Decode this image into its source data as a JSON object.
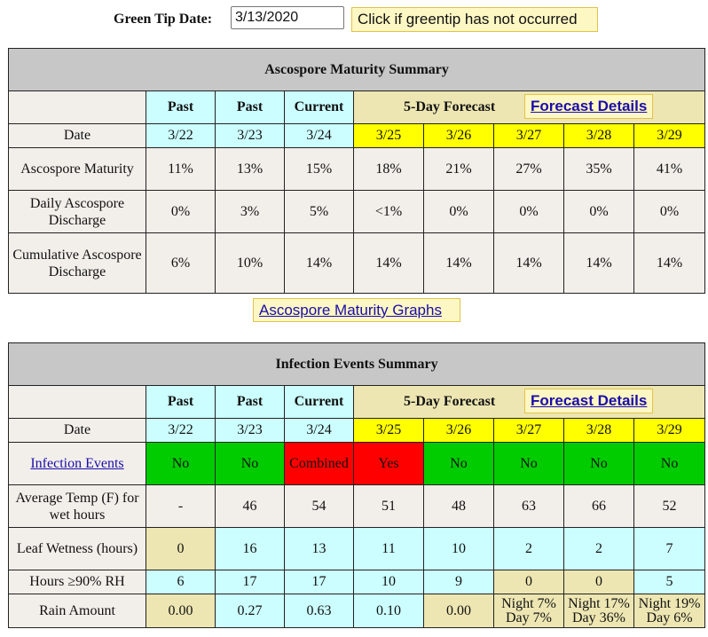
{
  "green_tip": {
    "label": "Green Tip Date:",
    "value": "3/13/2020",
    "button": "Click if greentip has not occurred"
  },
  "ascospore": {
    "title": "Ascospore Maturity Summary",
    "col_headers": [
      "Past",
      "Past",
      "Current"
    ],
    "forecast_label": "5-Day Forecast",
    "forecast_details": "Forecast Details",
    "rows": [
      {
        "label": "Date",
        "values": [
          "3/22",
          "3/23",
          "3/24",
          "3/25",
          "3/26",
          "3/27",
          "3/28",
          "3/29"
        ]
      },
      {
        "label": "Ascospore Maturity",
        "values": [
          "11%",
          "13%",
          "15%",
          "18%",
          "21%",
          "27%",
          "35%",
          "41%"
        ]
      },
      {
        "label": "Daily Ascospore Discharge",
        "values": [
          "0%",
          "3%",
          "5%",
          "<1%",
          "0%",
          "0%",
          "0%",
          "0%"
        ]
      },
      {
        "label": "Cumulative Ascospore Discharge",
        "values": [
          "6%",
          "10%",
          "14%",
          "14%",
          "14%",
          "14%",
          "14%",
          "14%"
        ]
      }
    ],
    "graphs_button": "Ascospore Maturity Graphs"
  },
  "infection": {
    "title": "Infection Events Summary",
    "col_headers": [
      "Past",
      "Past",
      "Current"
    ],
    "forecast_label": "5-Day Forecast",
    "forecast_details": "Forecast Details",
    "rows": [
      {
        "label": "Date",
        "values": [
          "3/22",
          "3/23",
          "3/24",
          "3/25",
          "3/26",
          "3/27",
          "3/28",
          "3/29"
        ]
      },
      {
        "label": "Infection Events",
        "values": [
          "No",
          "No",
          "Combined",
          "Yes",
          "No",
          "No",
          "No",
          "No"
        ]
      },
      {
        "label": "Average Temp (F) for wet hours",
        "values": [
          "-",
          "46",
          "54",
          "51",
          "48",
          "63",
          "66",
          "52"
        ]
      },
      {
        "label": "Leaf Wetness (hours)",
        "values": [
          "0",
          "16",
          "13",
          "11",
          "10",
          "2",
          "2",
          "7"
        ]
      },
      {
        "label": "Hours ≥90% RH",
        "values": [
          "6",
          "17",
          "17",
          "10",
          "9",
          "0",
          "0",
          "5"
        ]
      },
      {
        "label": "Rain Amount",
        "values": [
          "0.00",
          "0.27",
          "0.63",
          "0.10",
          "0.00",
          {
            "night": "Night 7%",
            "day": "Day 7%"
          },
          {
            "night": "Night 17%",
            "day": "Day 36%"
          },
          {
            "night": "Night 19%",
            "day": "Day 6%"
          }
        ]
      }
    ]
  },
  "colors": {
    "header_gray": "#c7c7c7",
    "cyan": "#ccfeff",
    "tan": "#ede6b2",
    "yellow": "#ffff00",
    "green": "#00cc00",
    "red": "#ff0000"
  }
}
